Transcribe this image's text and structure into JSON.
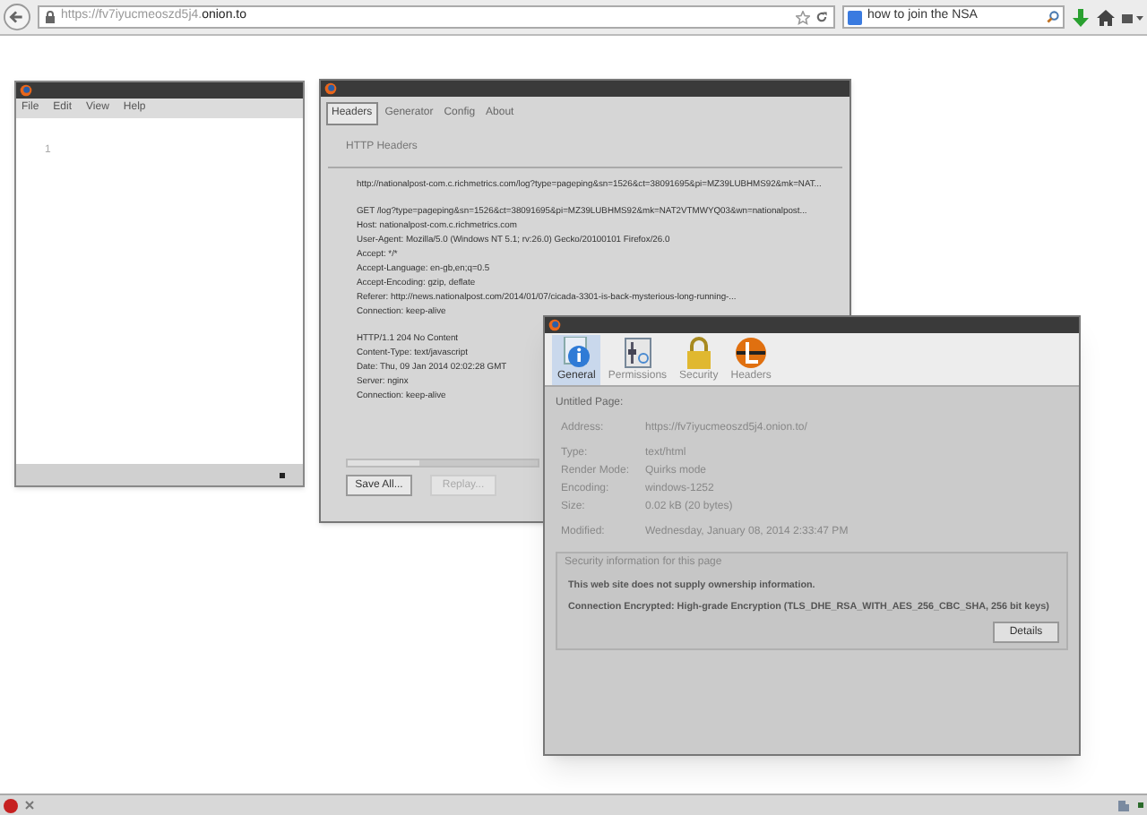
{
  "browser": {
    "url_prefix": "https://fv7iyucmeoszd5j4.",
    "url_domain": "onion.to",
    "search": "how to join the NSA"
  },
  "scratchpad": {
    "menu": [
      "File",
      "Edit",
      "View",
      "Help"
    ],
    "line_number": "1"
  },
  "http_headers": {
    "tabs": [
      {
        "label": "Headers",
        "selected": true
      },
      {
        "label": "Generator",
        "selected": false
      },
      {
        "label": "Config",
        "selected": false
      },
      {
        "label": "About",
        "selected": false
      }
    ],
    "section_title": "HTTP Headers",
    "blocks": [
      [
        "http://nationalpost-com.c.richmetrics.com/log?type=pageping&sn=1526&ct=38091695&pi=MZ39LUBHMS92&mk=NAT..."
      ],
      [
        "GET /log?type=pageping&sn=1526&ct=38091695&pi=MZ39LUBHMS92&mk=NAT2VTMWYQ03&wn=nationalpost...",
        "Host: nationalpost-com.c.richmetrics.com",
        "User-Agent: Mozilla/5.0 (Windows NT 5.1; rv:26.0) Gecko/20100101 Firefox/26.0",
        "Accept: */*",
        "Accept-Language: en-gb,en;q=0.5",
        "Accept-Encoding: gzip, deflate",
        "Referer: http://news.nationalpost.com/2014/01/07/cicada-3301-is-back-mysterious-long-running-...",
        "Connection: keep-alive"
      ],
      [
        "HTTP/1.1 204 No Content",
        "Content-Type: text/javascript",
        "Date: Thu, 09 Jan 2014 02:02:28 GMT",
        "Server: nginx",
        "Connection: keep-alive"
      ]
    ],
    "buttons": [
      {
        "label": "Save All...",
        "disabled": false
      },
      {
        "label": "Replay...",
        "disabled": true
      }
    ]
  },
  "page_info": {
    "tabs": [
      {
        "label": "General",
        "selected": true,
        "kind": "info"
      },
      {
        "label": "Permissions",
        "selected": false,
        "kind": "permissions"
      },
      {
        "label": "Security",
        "selected": false,
        "kind": "lock"
      },
      {
        "label": "Headers",
        "selected": false,
        "kind": "headers"
      }
    ],
    "page_title": "Untitled Page:",
    "groups": [
      [
        {
          "label": "Address:",
          "value": "https://fv7iyucmeoszd5j4.onion.to/"
        }
      ],
      [
        {
          "label": "Type:",
          "value": "text/html"
        },
        {
          "label": "Render Mode:",
          "value": "Quirks mode"
        },
        {
          "label": "Encoding:",
          "value": "windows-1252"
        },
        {
          "label": "Size:",
          "value": "0.02 kB (20 bytes)"
        }
      ],
      [
        {
          "label": "Modified:",
          "value": "Wednesday, January 08, 2014 2:33:47 PM"
        }
      ]
    ],
    "security": {
      "title": "Security information for this page",
      "lines": [
        "This web site does not supply ownership information.",
        "Connection Encrypted: High-grade Encryption (TLS_DHE_RSA_WITH_AES_256_CBC_SHA, 256 bit keys)"
      ],
      "button": "Details"
    }
  }
}
